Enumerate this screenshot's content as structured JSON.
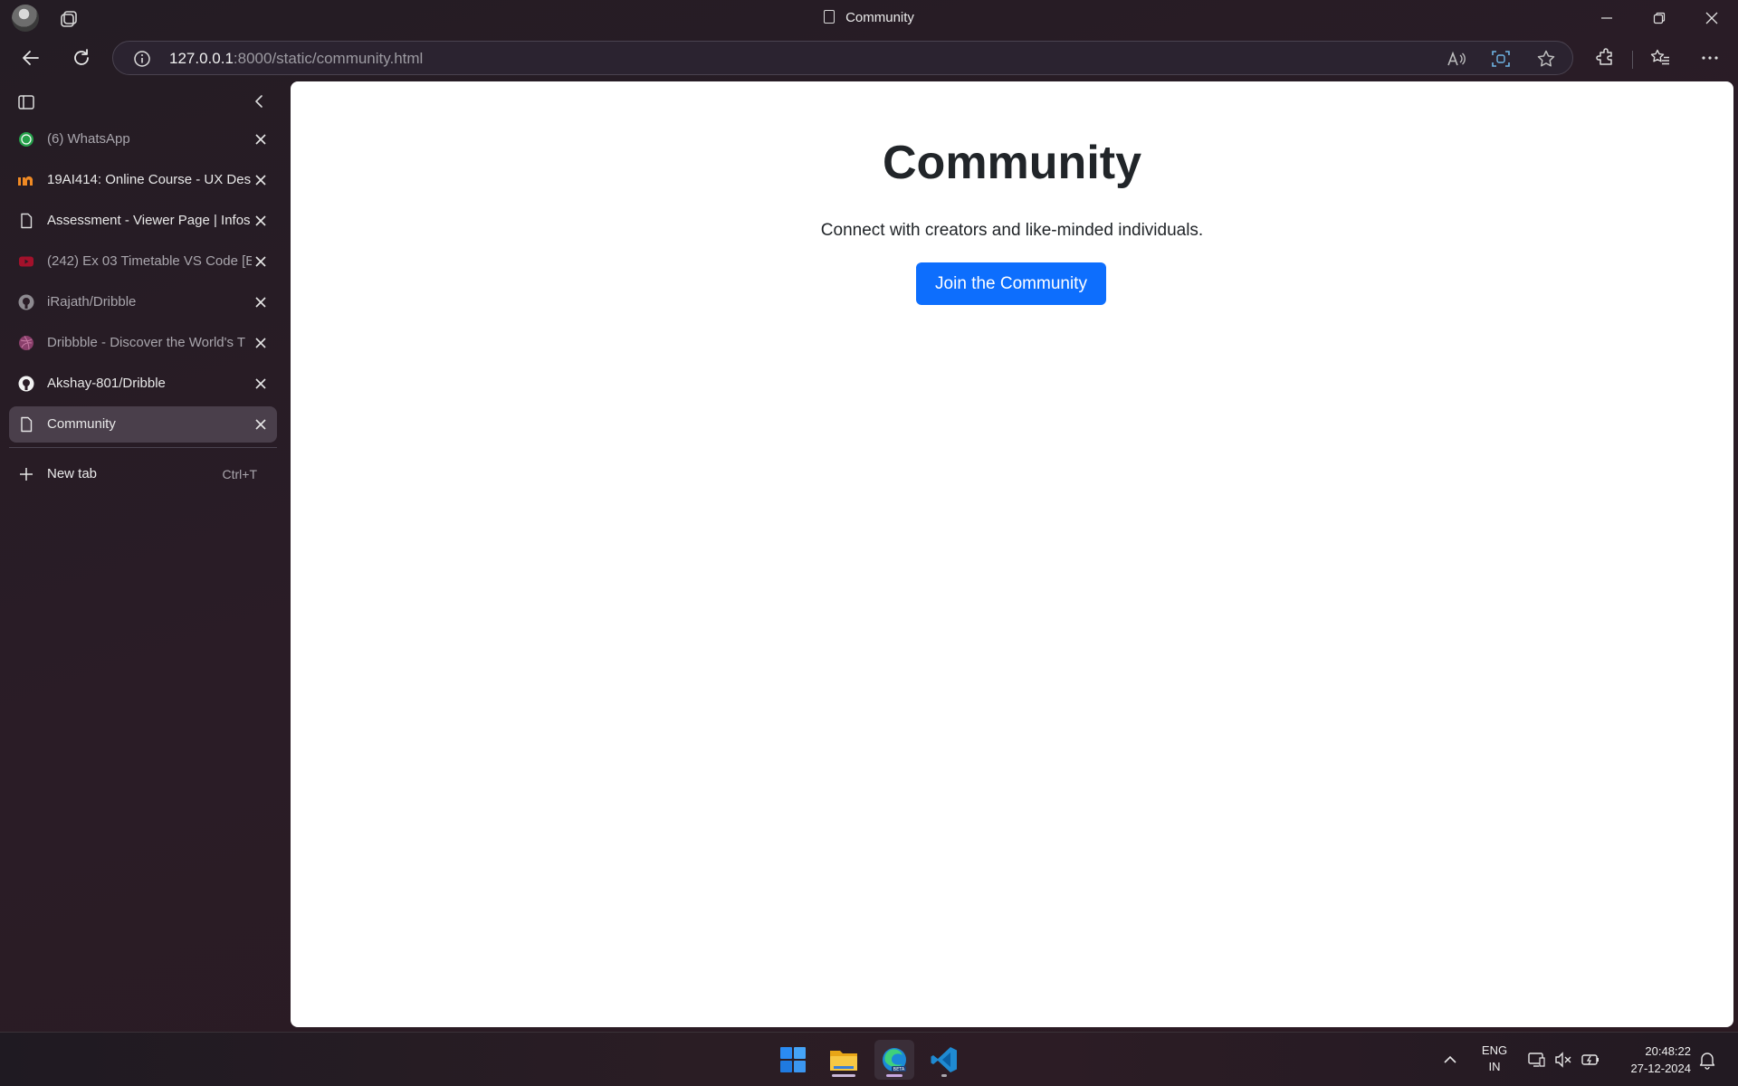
{
  "window": {
    "title": "Community"
  },
  "address": {
    "host": "127.0.0.1",
    "rest": ":8000/static/community.html"
  },
  "sidebar": {
    "tabs": [
      {
        "label": "(6) WhatsApp",
        "icon": "whatsapp-icon"
      },
      {
        "label": "19AI414: Online Course - UX Des",
        "icon": "in-logo-icon"
      },
      {
        "label": "Assessment - Viewer Page | Infos",
        "icon": "page-icon"
      },
      {
        "label": "(242) Ex 03 Timetable VS Code [E",
        "icon": "youtube-icon"
      },
      {
        "label": "iRajath/Dribble",
        "icon": "github-icon"
      },
      {
        "label": "Dribbble - Discover the World's T",
        "icon": "dribbble-icon"
      },
      {
        "label": "Akshay-801/Dribble",
        "icon": "github-icon"
      },
      {
        "label": "Community",
        "icon": "page-icon"
      }
    ],
    "new_tab": {
      "label": "New tab",
      "shortcut": "Ctrl+T"
    }
  },
  "page": {
    "heading": "Community",
    "subtitle": "Connect with creators and like-minded individuals.",
    "button": "Join the Community"
  },
  "taskbar": {
    "lang_top": "ENG",
    "lang_bottom": "IN",
    "time": "20:48:22",
    "date": "27-12-2024"
  },
  "colors": {
    "accent": "#0d6efd",
    "active_tab": "#4a3f4b"
  }
}
